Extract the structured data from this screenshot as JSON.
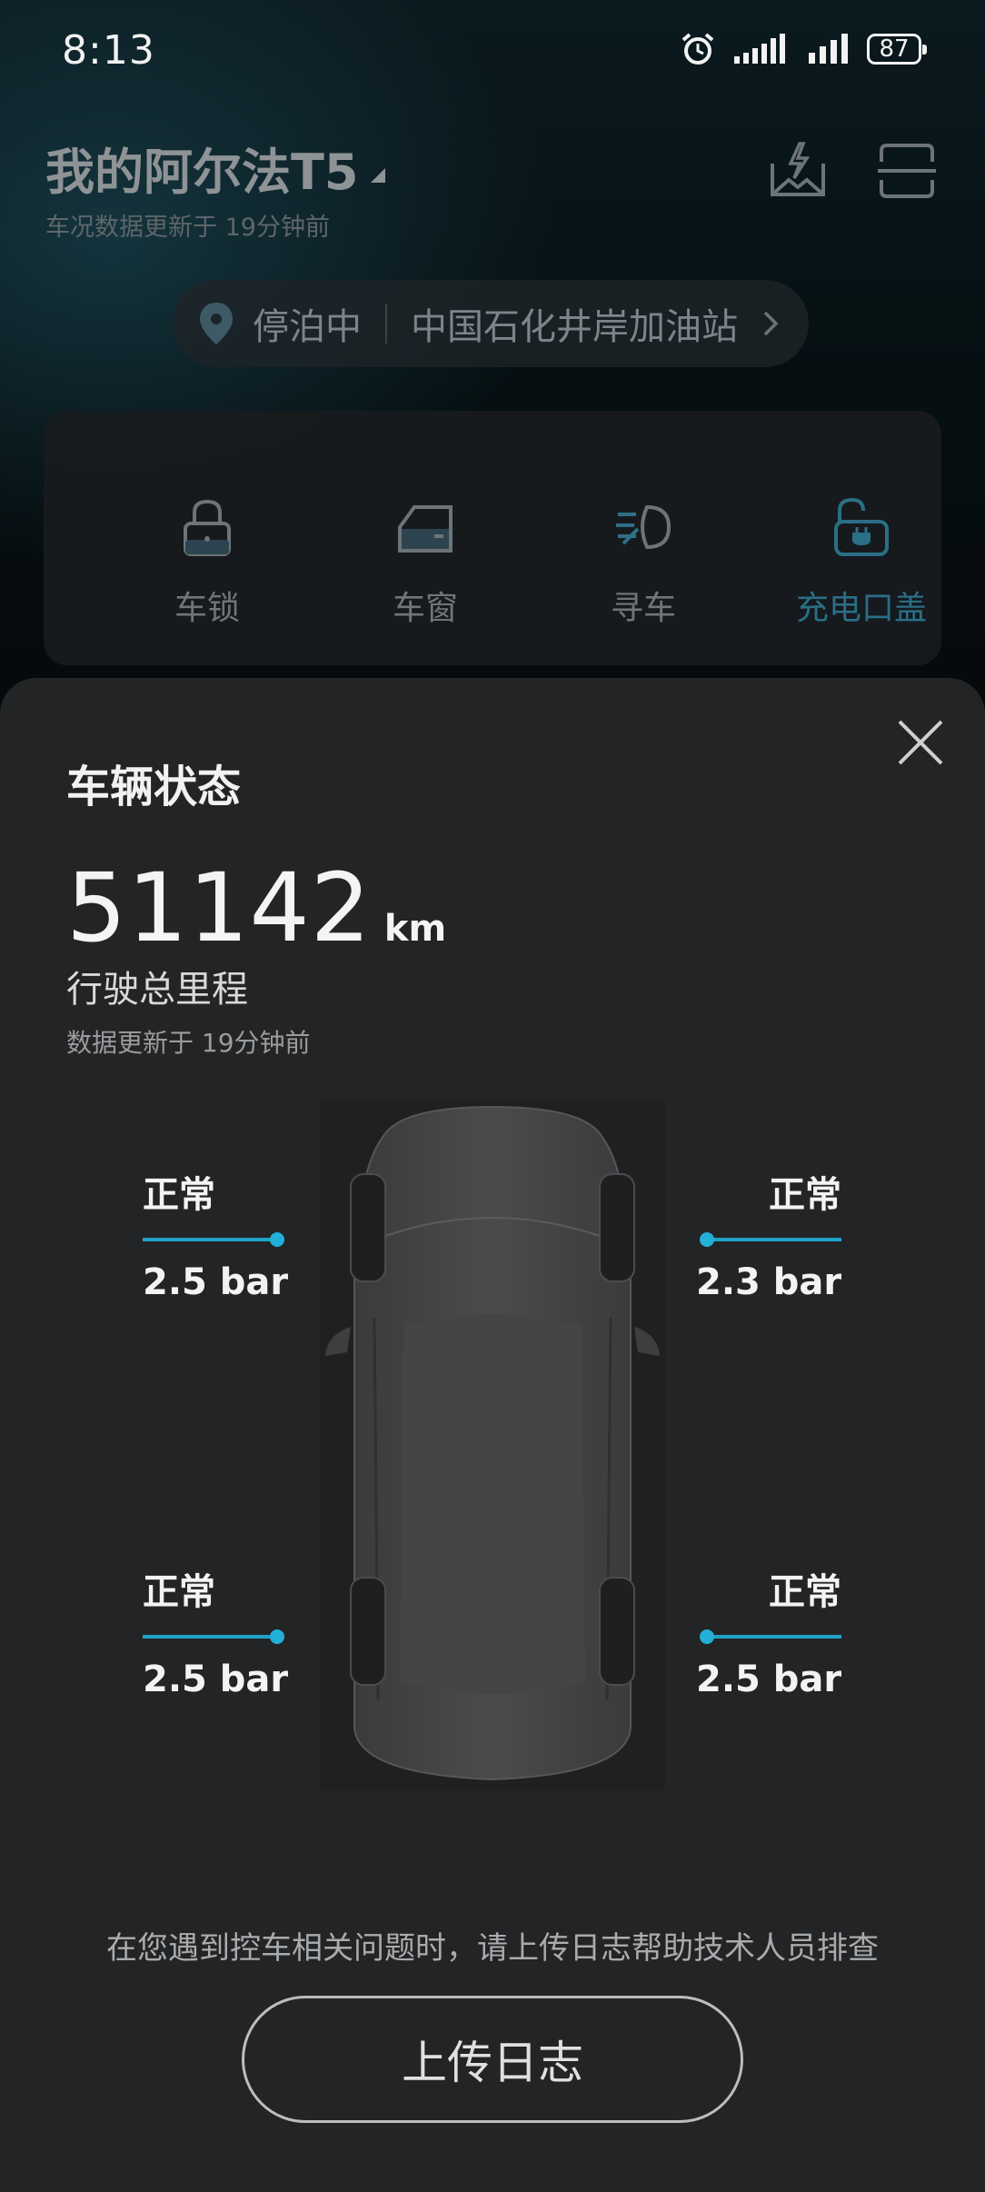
{
  "status_bar": {
    "time": "8:13",
    "battery": "87",
    "icons": [
      "alarm-icon",
      "signal-icon",
      "signal-icon"
    ]
  },
  "header": {
    "vehicle_name": "我的阿尔法T5",
    "data_updated": "车况数据更新于 19分钟前",
    "right_icons": [
      "charging-station-icon",
      "scan-icon"
    ]
  },
  "location": {
    "status": "停泊中",
    "place": "中国石化井岸加油站",
    "icon": "location-pin-icon"
  },
  "controls": [
    {
      "label": "车锁",
      "icon": "lock-icon"
    },
    {
      "label": "车窗",
      "icon": "car-window-icon"
    },
    {
      "label": "寻车",
      "icon": "headlight-icon"
    },
    {
      "label": "充电口盖",
      "icon": "charge-port-icon"
    }
  ],
  "colors": {
    "accent": "#2a6f86",
    "tire_line": "#1fa2c7",
    "sheet_bg": "#232426"
  },
  "sheet": {
    "title": "车辆状态",
    "odometer": {
      "value": "51142",
      "unit": "km",
      "label": "行驶总里程"
    },
    "data_updated": "数据更新于 19分钟前",
    "tires": {
      "front_left": {
        "status": "正常",
        "pressure": "2.5 bar"
      },
      "front_right": {
        "status": "正常",
        "pressure": "2.3 bar"
      },
      "rear_left": {
        "status": "正常",
        "pressure": "2.5 bar"
      },
      "rear_right": {
        "status": "正常",
        "pressure": "2.5 bar"
      }
    },
    "hint": "在您遇到控车相关问题时，请上传日志帮助技术人员排查",
    "upload_button": "上传日志"
  }
}
